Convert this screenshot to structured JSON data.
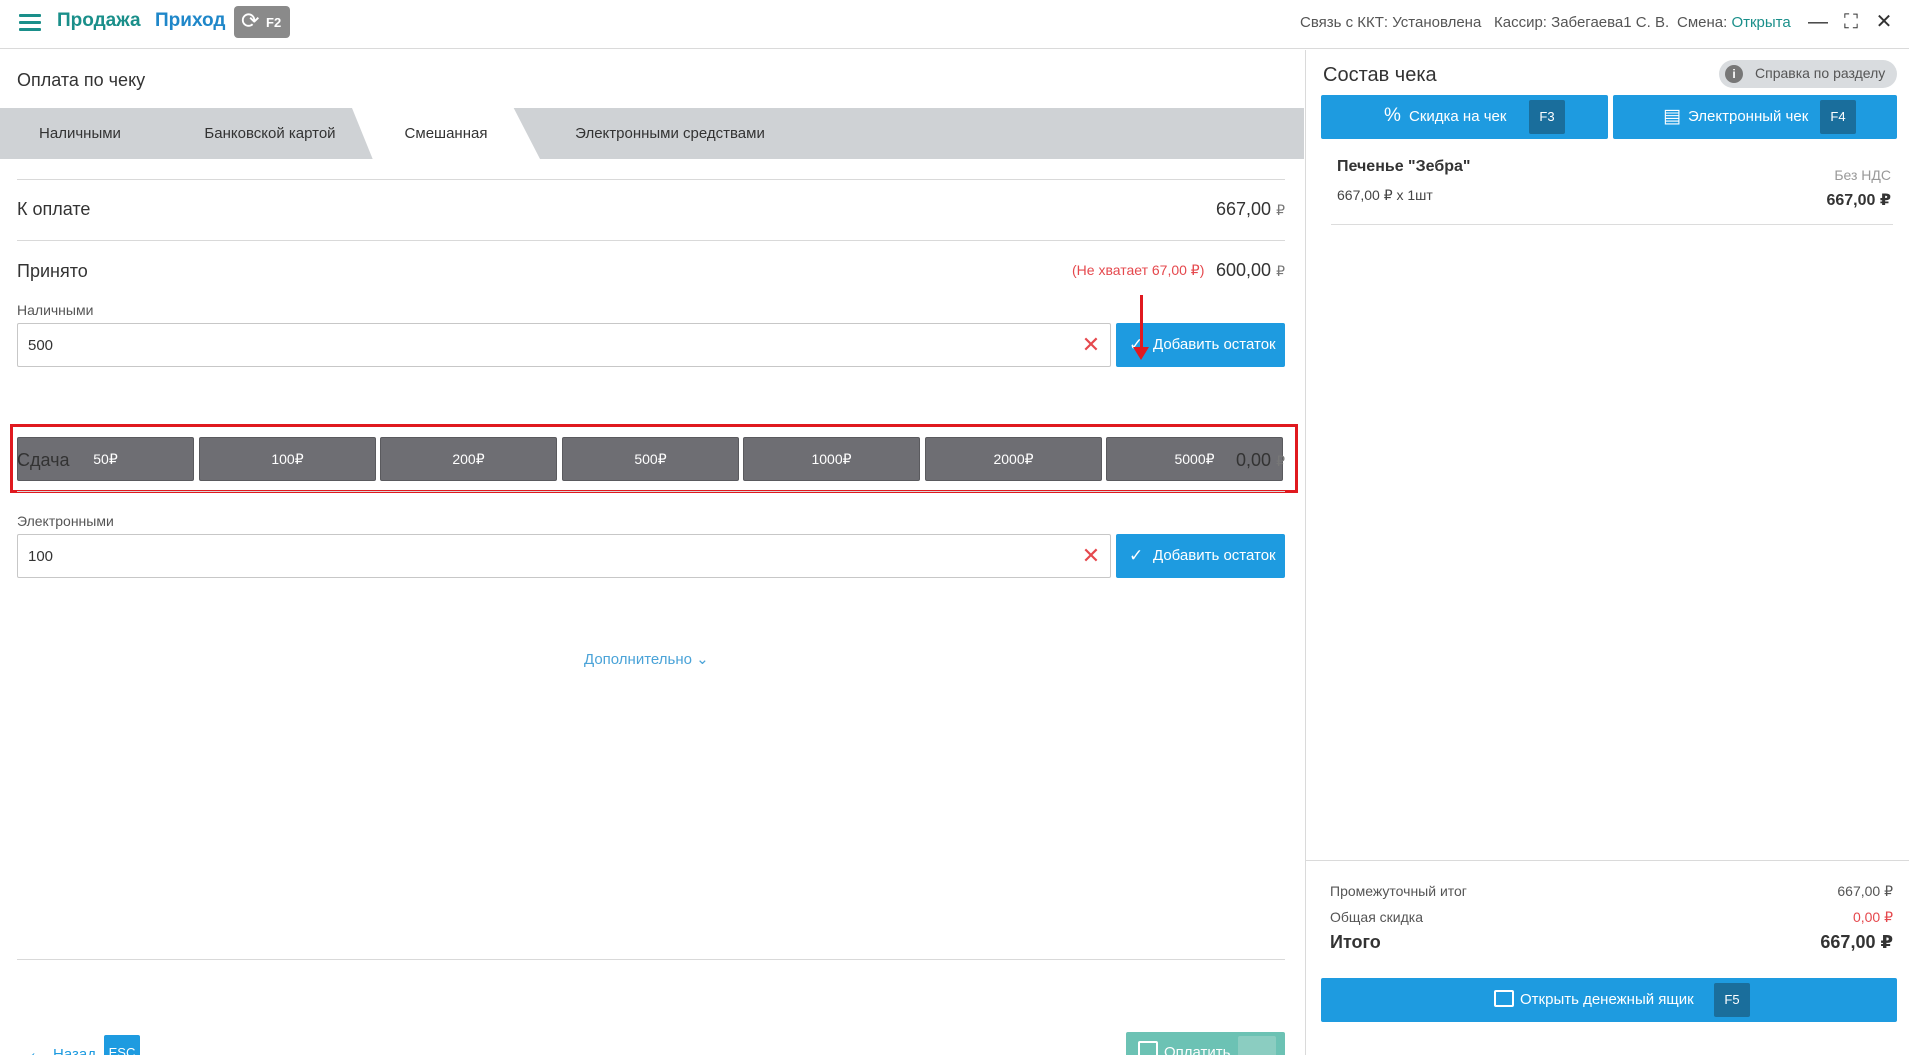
{
  "topbar": {
    "nav_sale": "Продажа",
    "nav_income": "Приход",
    "sync_key": "F2",
    "kkt_label": "Связь с ККТ: Установлена",
    "cashier_label": "Кассир: Забегаева1 С. В.",
    "shift_label": "Смена: ",
    "shift_status": "Открыта",
    "accent_color": "#1a8f8a"
  },
  "payment": {
    "title": "Оплата по чеку",
    "tabs": [
      "Наличными",
      "Банковской картой",
      "Смешанная",
      "Электронными средствами"
    ],
    "active_tab": "Смешанная",
    "to_pay_label": "К оплате",
    "to_pay_value": "667,00",
    "currency": "₽",
    "accepted_label": "Принято",
    "shortage": "(Не хватает 67,00 ₽)",
    "accepted_value": "600,00",
    "cash_label": "Наличными",
    "cash_value": "500",
    "add_rest_label": "Добавить остаток",
    "quick_amounts": [
      "50₽",
      "100₽",
      "200₽",
      "500₽",
      "1000₽",
      "2000₽",
      "5000₽"
    ],
    "change_label": "Сдача",
    "change_value": "0,00",
    "electronic_label": "Электронными",
    "electronic_value": "100",
    "more_label": "Дополнительно",
    "back_label": "Назад",
    "back_key": "ESC",
    "pay_label": "Оплатить",
    "pay_key": "_"
  },
  "receipt": {
    "title": "Состав чека",
    "help_label": "Справка по разделу",
    "discount_label": "Скидка на чек",
    "discount_key": "F3",
    "ereceipt_label": "Электронный чек",
    "ereceipt_key": "F4",
    "item_name": "Печенье \"Зебра\"",
    "item_qty": "667,00 ₽ х 1шт",
    "item_vat": "Без НДС",
    "item_sum": "667,00 ₽",
    "subtotal_label": "Промежуточный итог",
    "subtotal_value": "667,00 ₽",
    "discount_total_label": "Общая скидка",
    "discount_total_value": "0,00 ₽",
    "total_label": "Итого",
    "total_value": "667,00 ₽",
    "drawer_label": "Открыть денежный ящик",
    "drawer_key": "F5"
  }
}
